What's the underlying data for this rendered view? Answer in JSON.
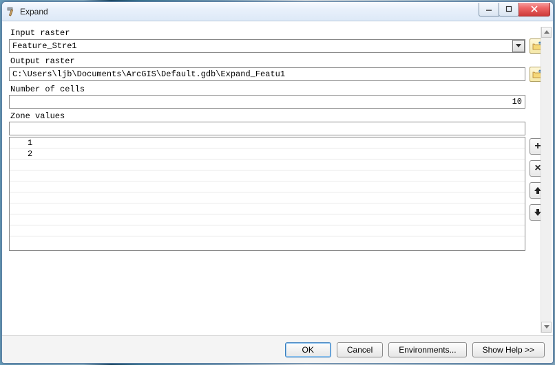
{
  "window": {
    "title": "Expand"
  },
  "fields": {
    "input_raster": {
      "label": "Input raster",
      "value": "Feature_Stre1"
    },
    "output_raster": {
      "label": "Output raster",
      "value": "C:\\Users\\ljb\\Documents\\ArcGIS\\Default.gdb\\Expand_Featu1"
    },
    "number_of_cells": {
      "label": "Number of cells",
      "value": "10"
    },
    "zone_values": {
      "label": "Zone values",
      "input_value": "",
      "items": [
        "1",
        "2"
      ]
    }
  },
  "buttons": {
    "ok": "OK",
    "cancel": "Cancel",
    "environments": "Environments...",
    "show_help": "Show Help >>"
  },
  "icons": {
    "add": "+",
    "remove": "×",
    "up": "🡡",
    "down": "🡣"
  }
}
